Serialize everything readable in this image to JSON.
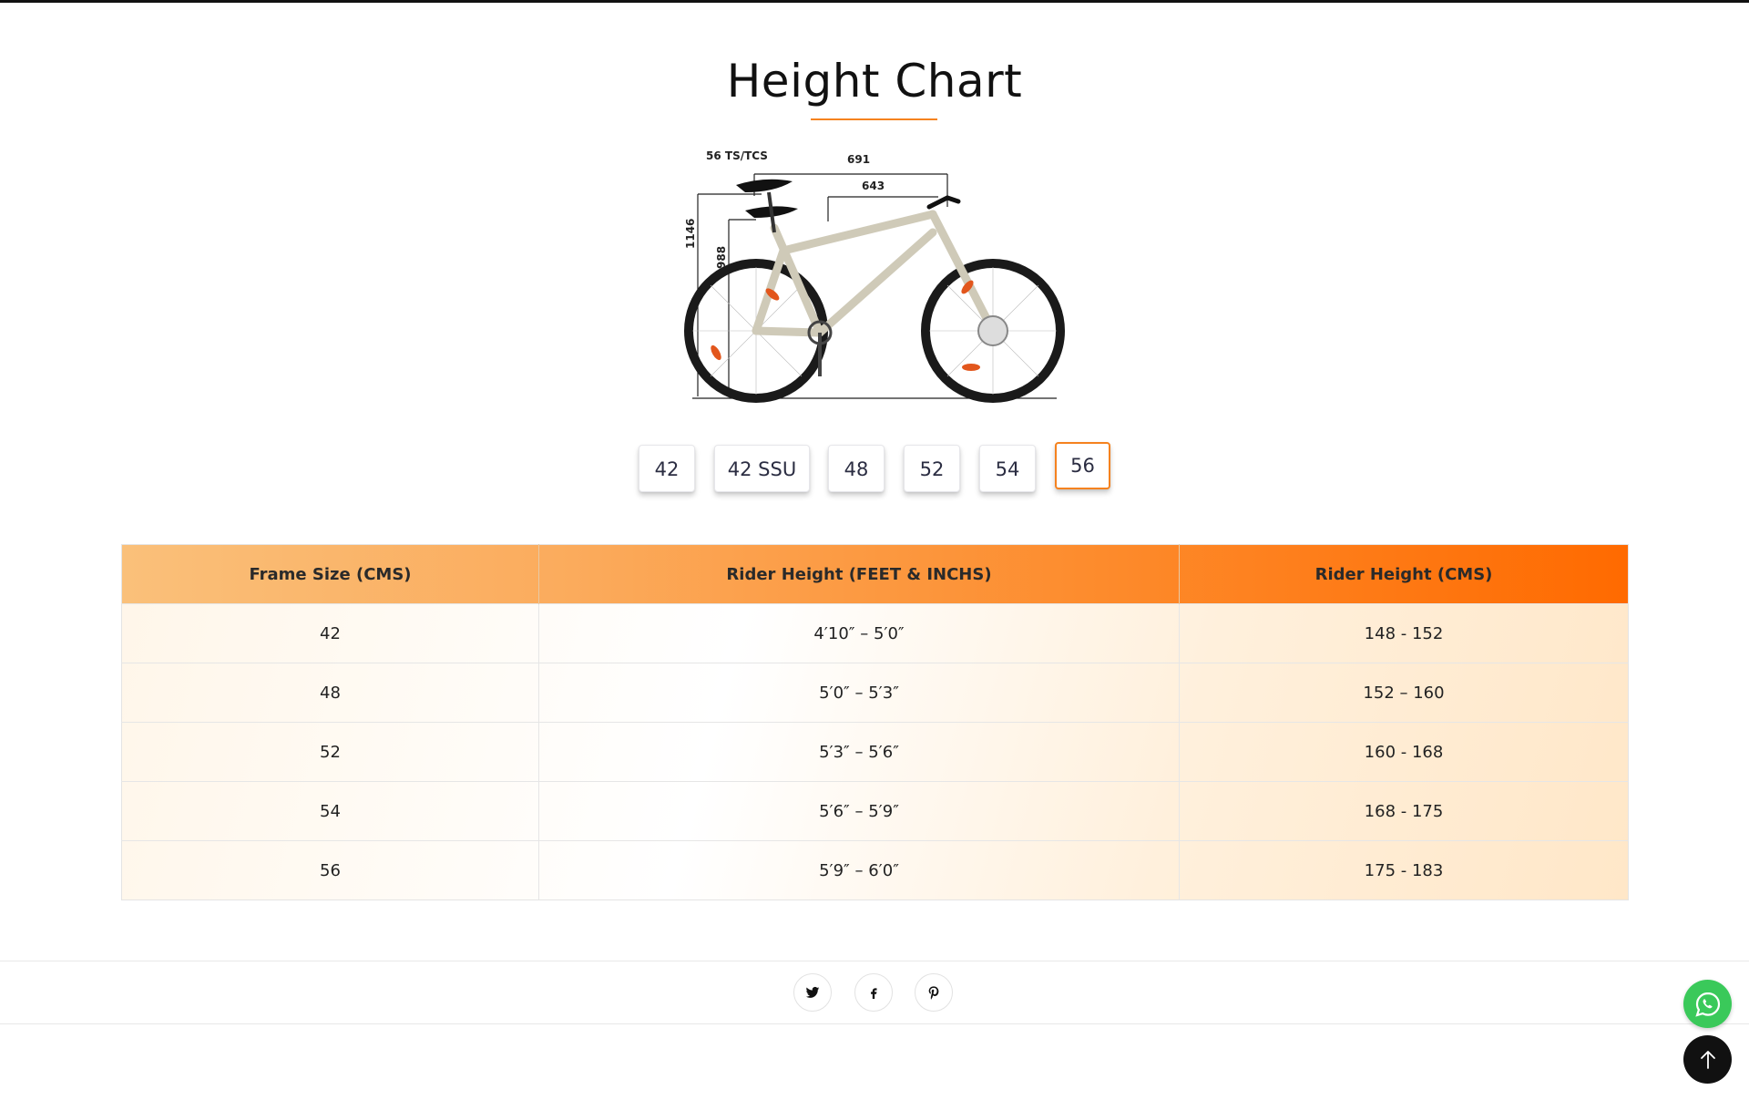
{
  "page": {
    "title": "Height Chart"
  },
  "bike_image": {
    "icon": "bicycle-geometry-diagram",
    "labels": {
      "model": "56 TS/TCS",
      "reach_top": "691",
      "reach_bottom": "643",
      "stack_tall": "1146",
      "stack_short": "988"
    }
  },
  "size_tabs": {
    "items": [
      "42",
      "42 SSU",
      "48",
      "52",
      "54",
      "56"
    ],
    "active": "56"
  },
  "table": {
    "headers": [
      "Frame Size (CMS)",
      "Rider Height (FEET & INCHS)",
      "Rider Height (CMS)"
    ],
    "rows": [
      [
        "42",
        "4′10″ – 5′0″",
        "148 - 152"
      ],
      [
        "48",
        "5′0″ – 5′3″",
        "152 – 160"
      ],
      [
        "52",
        "5′3″ – 5′6″",
        "160 - 168"
      ],
      [
        "54",
        "5′6″ – 5′9″",
        "168 - 175"
      ],
      [
        "56",
        "5′9″ – 6′0″",
        "175 - 183"
      ]
    ],
    "header_gradient": [
      "#fac07a",
      "#ff6a00"
    ]
  },
  "share": {
    "icons": [
      "twitter-icon",
      "facebook-icon",
      "pinterest-icon"
    ]
  },
  "floating": {
    "whatsapp_icon": "whatsapp-icon",
    "back_to_top_icon": "arrow-up-icon"
  },
  "colors": {
    "accent": "#f5821f",
    "whatsapp": "#3ac95a"
  }
}
